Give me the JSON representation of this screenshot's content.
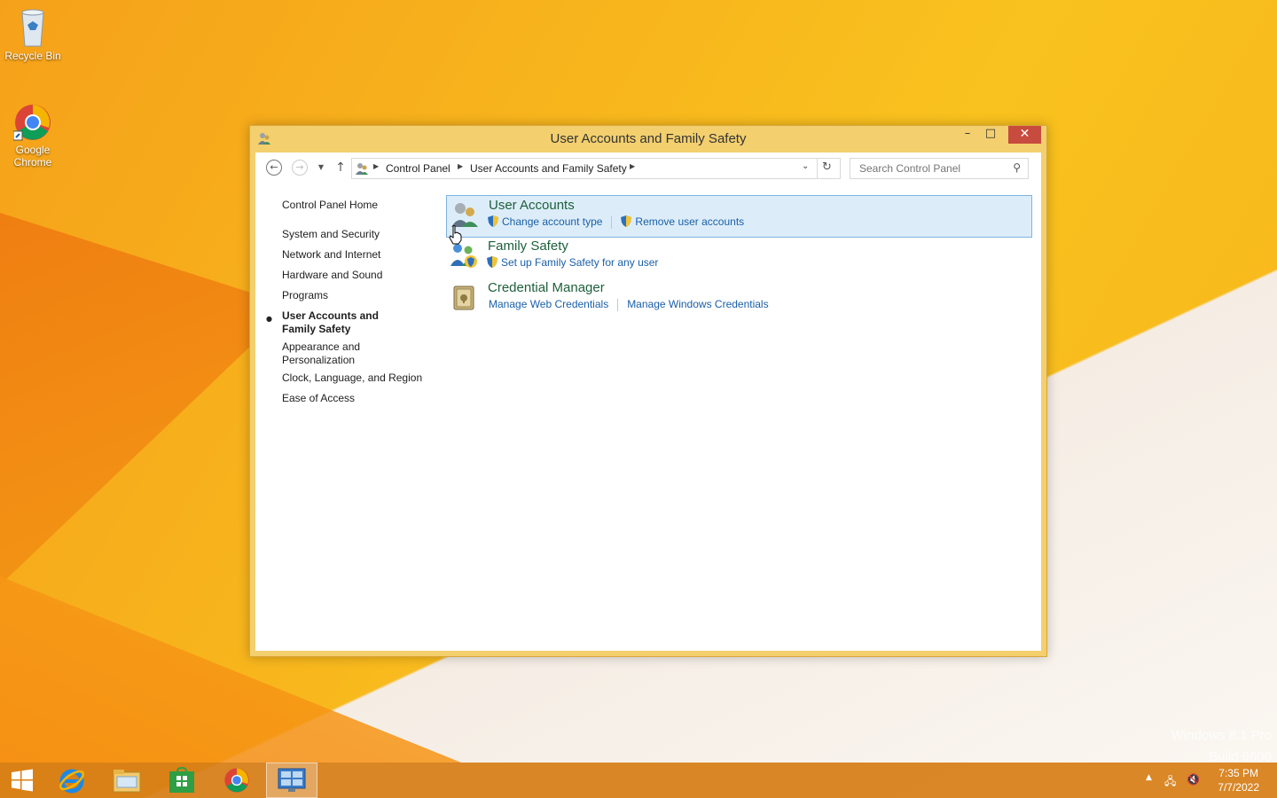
{
  "desktop": {
    "icons": [
      {
        "label": "Recycle Bin",
        "icon": "recycle-bin-icon"
      },
      {
        "label": "Google Chrome",
        "icon": "chrome-icon"
      }
    ],
    "watermark": {
      "line1": "Windows 8.1 Pro",
      "line2": "Build 9600"
    }
  },
  "window": {
    "title": "User Accounts and Family Safety",
    "controls": {
      "minimize": "–",
      "maximize": "□",
      "close": "✕"
    }
  },
  "navbar": {
    "breadcrumb": [
      "Control Panel",
      "User Accounts and Family Safety"
    ],
    "search_placeholder": "Search Control Panel"
  },
  "sidebar": {
    "home": "Control Panel Home",
    "items": [
      {
        "label": "System and Security",
        "active": false
      },
      {
        "label": "Network and Internet",
        "active": false
      },
      {
        "label": "Hardware and Sound",
        "active": false
      },
      {
        "label": "Programs",
        "active": false
      },
      {
        "label": "User Accounts and Family Safety",
        "active": true
      },
      {
        "label": "Appearance and Personalization",
        "active": false
      },
      {
        "label": "Clock, Language, and Region",
        "active": false
      },
      {
        "label": "Ease of Access",
        "active": false
      }
    ]
  },
  "categories": [
    {
      "title": "User Accounts",
      "links": [
        "Change account type",
        "Remove user accounts"
      ]
    },
    {
      "title": "Family Safety",
      "links": [
        "Set up Family Safety for any user"
      ]
    },
    {
      "title": "Credential Manager",
      "links": [
        "Manage Web Credentials",
        "Manage Windows Credentials"
      ]
    }
  ],
  "taskbar": {
    "apps": [
      "start-icon",
      "internet-explorer-icon",
      "file-explorer-icon",
      "store-icon",
      "chrome-icon",
      "control-panel-icon"
    ],
    "clock": {
      "time": "7:35 PM",
      "date": "7/7/2022"
    }
  },
  "colors": {
    "accent": "#f3cf6e",
    "link": "#1a5fa8",
    "category_title": "#1e5f3b",
    "hover_bg": "#dcedf9"
  }
}
